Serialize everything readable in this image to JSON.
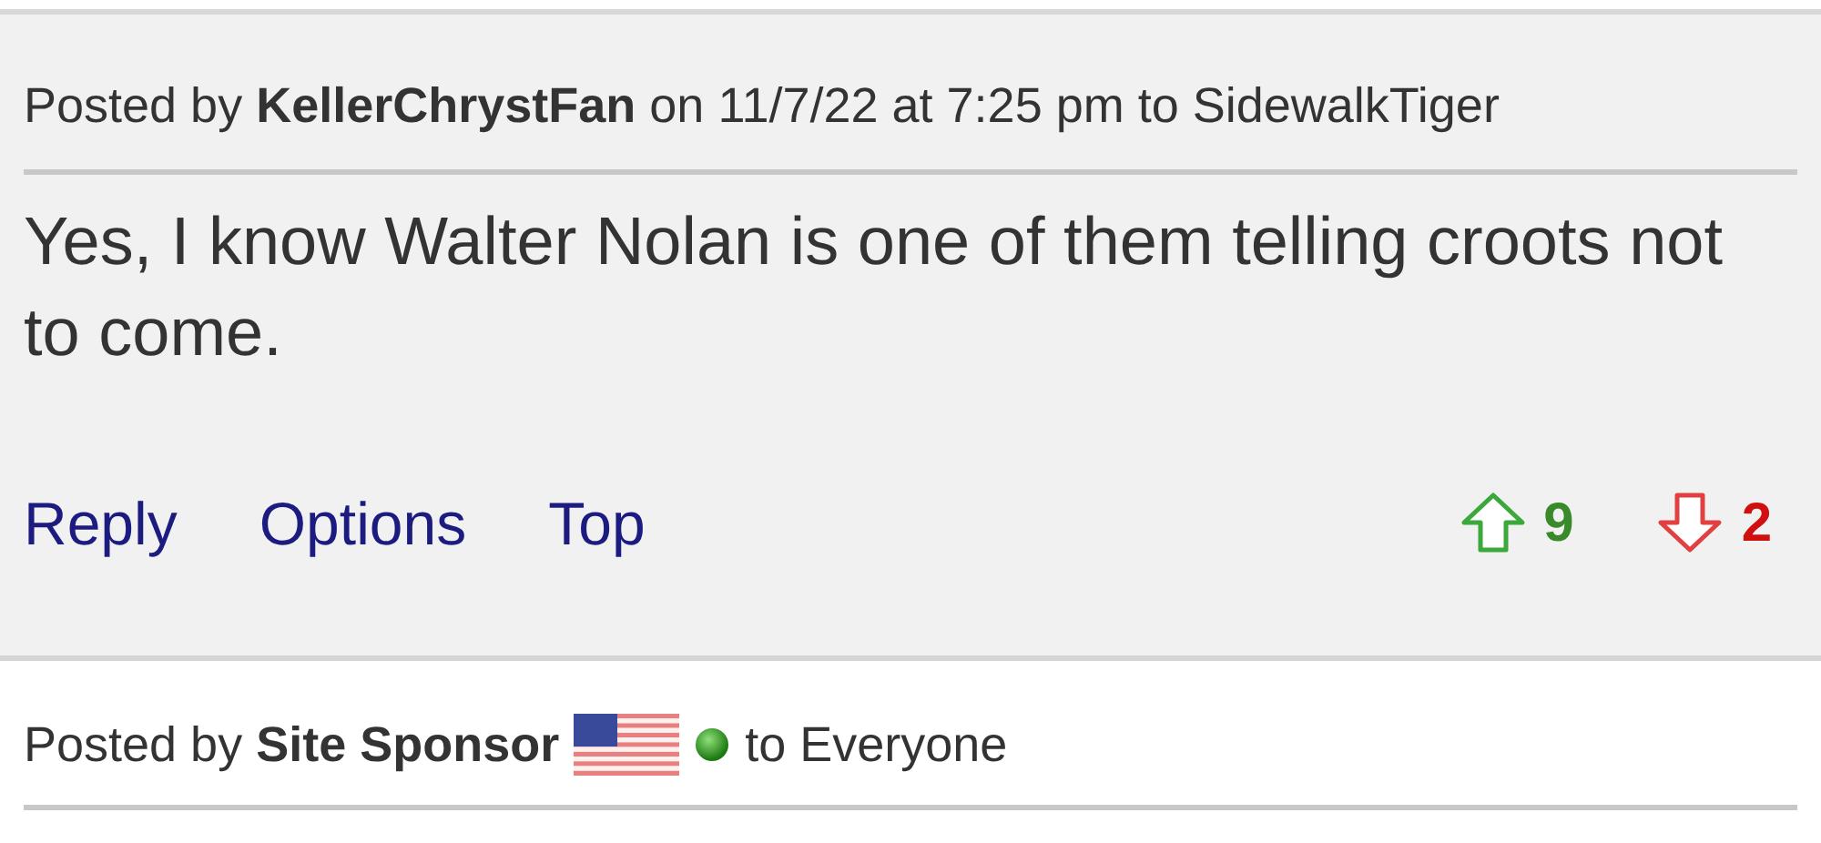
{
  "posts": [
    {
      "byline": "Posted by **KellerChrystFan** on 11/7/22 at 7:25 pm to SidewalkTiger",
      "body": "Yes, I know Walter Nolan is one of them telling croots not to come.",
      "actions": [
        "Reply",
        "Options",
        "Top"
      ],
      "upvotes": "9",
      "downvotes": "2"
    },
    {
      "byline": "Posted by **Site Sponsor**",
      "recipient": "to Everyone"
    }
  ]
}
